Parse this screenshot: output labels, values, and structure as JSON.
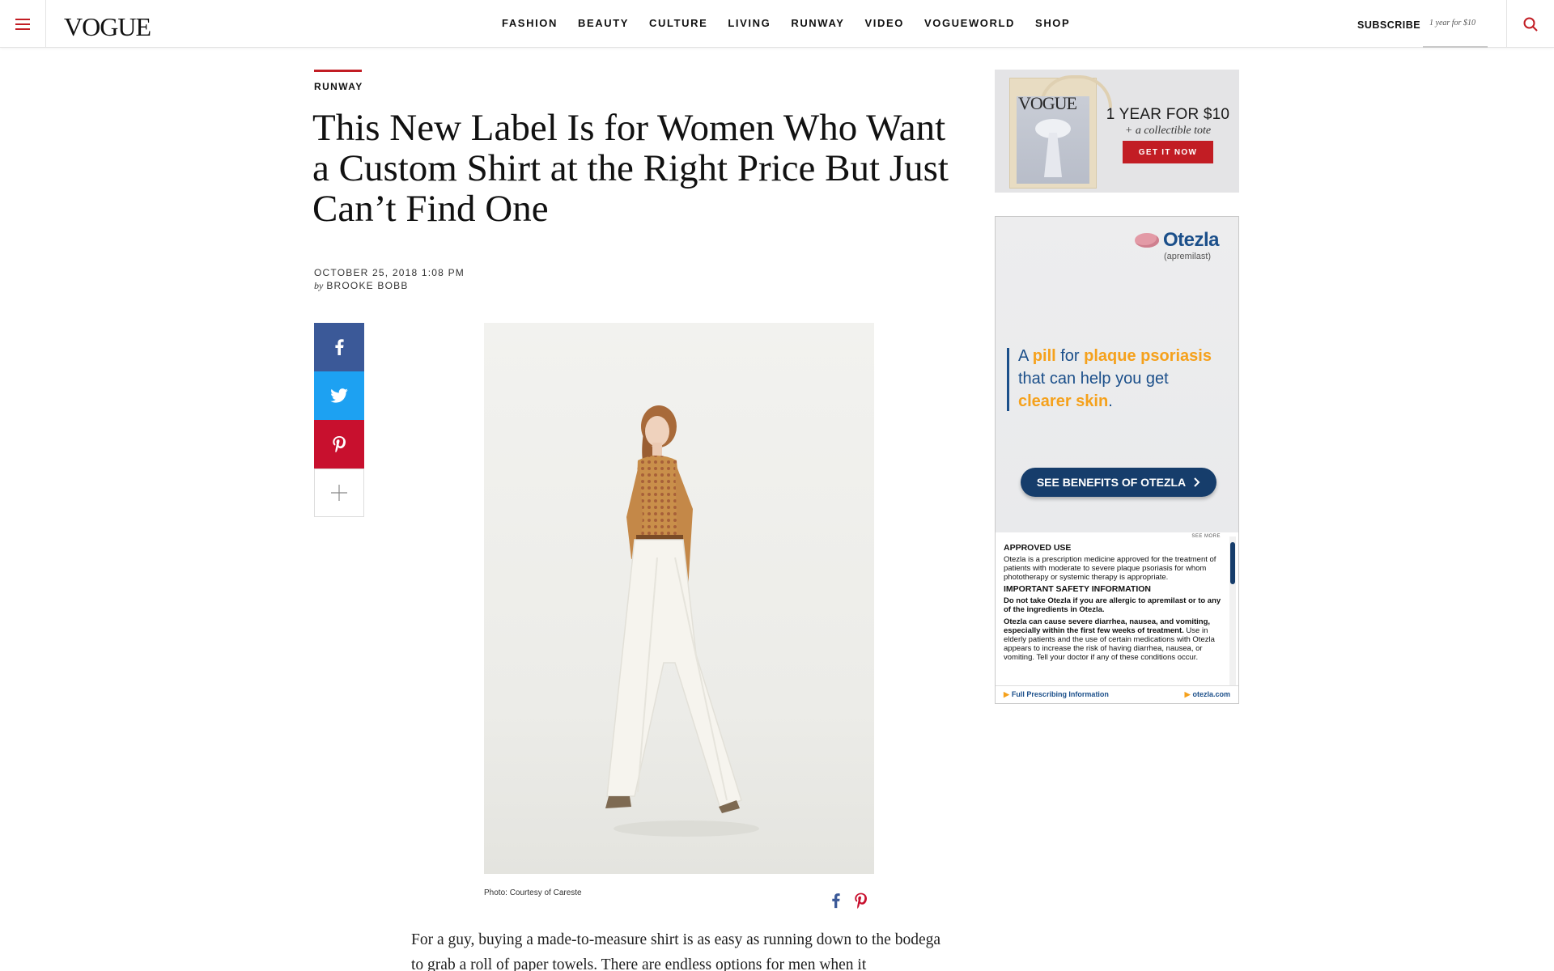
{
  "header": {
    "logo": "VOGUE",
    "nav": [
      "FASHION",
      "BEAUTY",
      "CULTURE",
      "LIVING",
      "RUNWAY",
      "VIDEO",
      "VOGUEWORLD",
      "SHOP"
    ],
    "subscribe_label": "SUBSCRIBE",
    "subscribe_offer": "1 year for $10"
  },
  "article": {
    "kicker": "RUNWAY",
    "headline": "This New Label Is for Women Who Want a Custom Shirt at the Right Price But Just Can’t Find One",
    "date": "OCTOBER 25, 2018 1:08 PM",
    "byline_prefix": "by",
    "author": "BROOKE BOBB",
    "photo_caption": "Photo: Courtesy of Careste",
    "body": "For a guy, buying a made-to-measure shirt is as easy as running down to the bodega to grab a roll of paper towels. There are endless options for men when it"
  },
  "share": {
    "icons": [
      "facebook-icon",
      "twitter-icon",
      "pinterest-icon",
      "plus-icon"
    ]
  },
  "ads": {
    "vogue": {
      "tote_logo": "VOGUE",
      "headline": "1 YEAR FOR $10",
      "subline": "+ a collectible tote",
      "cta": "GET IT NOW"
    },
    "otezla": {
      "brand": "Otezla",
      "generic": "(apremilast)",
      "tagline_parts": [
        "A ",
        "pill",
        " for ",
        "plaque psoriasis",
        " that can help you get ",
        "clearer skin",
        "."
      ],
      "cta": "SEE BENEFITS OF OTEZLA",
      "see_more": "SEE MORE",
      "approved_use_title": "APPROVED USE",
      "approved_use_text": "Otezla is a prescription medicine approved for the treatment of patients with moderate to severe plaque psoriasis for whom phototherapy or systemic therapy is appropriate.",
      "safety_title": "IMPORTANT SAFETY INFORMATION",
      "safety_bold_1": "Do not take Otezla if you are allergic to apremilast or to any of the ingredients in Otezla.",
      "safety_bold_2": "Otezla can cause severe diarrhea, nausea, and vomiting, especially within the first few weeks of treatment.",
      "safety_text": " Use in elderly patients and the use of certain medications with Otezla appears to increase the risk of having diarrhea, nausea, or vomiting. Tell your doctor if any of these conditions occur.",
      "footer_left": "Full Prescribing Information",
      "footer_right": "otezla.com"
    }
  },
  "colors": {
    "accent_red": "#c21d24",
    "facebook": "#3b5998",
    "twitter": "#1da1f2",
    "pinterest": "#c8102e",
    "otezla_blue": "#1b4f8a",
    "otezla_orange": "#f5a11c"
  }
}
